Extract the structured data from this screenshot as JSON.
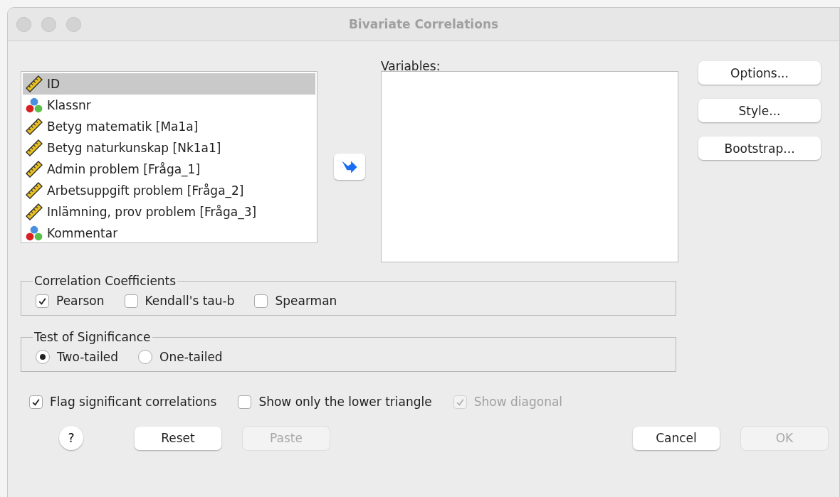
{
  "window": {
    "title": "Bivariate Correlations"
  },
  "source_list": {
    "items": [
      {
        "label": "ID",
        "kind": "scale",
        "selected": true
      },
      {
        "label": "Klassnr",
        "kind": "nominal",
        "selected": false
      },
      {
        "label": "Betyg matematik [Ma1a]",
        "kind": "scale",
        "selected": false
      },
      {
        "label": "Betyg naturkunskap [Nk1a1]",
        "kind": "scale",
        "selected": false
      },
      {
        "label": "Admin problem [Fråga_1]",
        "kind": "scale",
        "selected": false
      },
      {
        "label": "Arbetsuppgift problem [Fråga_2]",
        "kind": "scale",
        "selected": false
      },
      {
        "label": "Inlämning, prov problem [Fråga_3]",
        "kind": "scale",
        "selected": false
      },
      {
        "label": "Kommentar",
        "kind": "nominal",
        "selected": false
      }
    ]
  },
  "variables": {
    "label": "Variables:"
  },
  "side_buttons": [
    {
      "label": "Options..."
    },
    {
      "label": "Style..."
    },
    {
      "label": "Bootstrap..."
    }
  ],
  "correlation_coefficients": {
    "title": "Correlation Coefficients",
    "options": [
      {
        "label": "Pearson",
        "checked": true
      },
      {
        "label": "Kendall's tau-b",
        "checked": false
      },
      {
        "label": "Spearman",
        "checked": false
      }
    ]
  },
  "test_of_significance": {
    "title": "Test of Significance",
    "options": [
      {
        "label": "Two-tailed",
        "selected": true
      },
      {
        "label": "One-tailed",
        "selected": false
      }
    ]
  },
  "flags": [
    {
      "label": "Flag significant correlations",
      "checked": true,
      "disabled": false
    },
    {
      "label": "Show only the lower triangle",
      "checked": false,
      "disabled": false
    },
    {
      "label": "Show diagonal",
      "checked": true,
      "disabled": true
    }
  ],
  "help_button": {
    "label": "?"
  },
  "buttons_left": [
    {
      "label": "Reset",
      "disabled": false
    },
    {
      "label": "Paste",
      "disabled": true
    }
  ],
  "buttons_right": [
    {
      "label": "Cancel",
      "disabled": false
    },
    {
      "label": "OK",
      "disabled": true
    }
  ]
}
